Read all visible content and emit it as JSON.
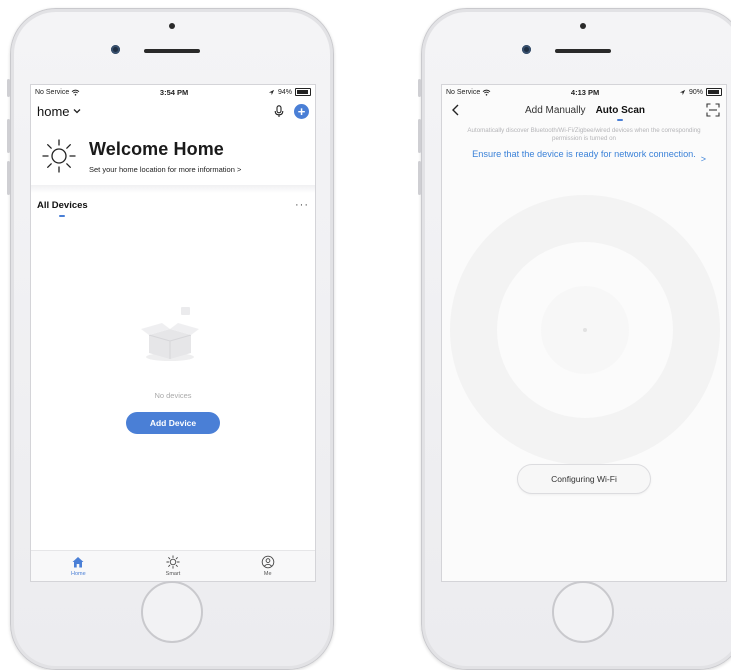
{
  "left_phone": {
    "status_bar": {
      "carrier": "No Service",
      "time": "3:54 PM",
      "battery": "94%",
      "battery_level": 0.94
    },
    "header": {
      "home_name": "home"
    },
    "welcome": {
      "title": "Welcome Home",
      "subtitle": "Set your home location for more information >"
    },
    "devices": {
      "title": "All Devices",
      "more": "···",
      "empty_text": "No devices",
      "add_button": "Add Device"
    },
    "tabbar": {
      "tabs": [
        {
          "label": "Home"
        },
        {
          "label": "Smart"
        },
        {
          "label": "Me"
        }
      ],
      "active_index": 0
    }
  },
  "right_phone": {
    "status_bar": {
      "carrier": "No Service",
      "time": "4:13 PM",
      "battery": "90%",
      "battery_level": 0.9
    },
    "nav": {
      "tab_manual": "Add Manually",
      "tab_auto": "Auto Scan"
    },
    "description": "Automatically discover Bluetooth/Wi-Fi/Zigbee/wired devices when the corresponding permission is turned on",
    "ensure_link": "Ensure that the device is ready for network connection.",
    "ensure_arrow": ">",
    "config_button": "Configuring Wi-Fi"
  },
  "colors": {
    "accent": "#4a7fd6",
    "link": "#3b82d8"
  },
  "icons": [
    "sun-icon",
    "microphone-icon",
    "plus-circle-icon",
    "chevron-down-icon",
    "empty-box-icon",
    "home-icon",
    "smart-sun-icon",
    "user-circle-icon",
    "back-chevron-icon",
    "scan-frame-icon",
    "wifi-icon",
    "location-icon"
  ]
}
